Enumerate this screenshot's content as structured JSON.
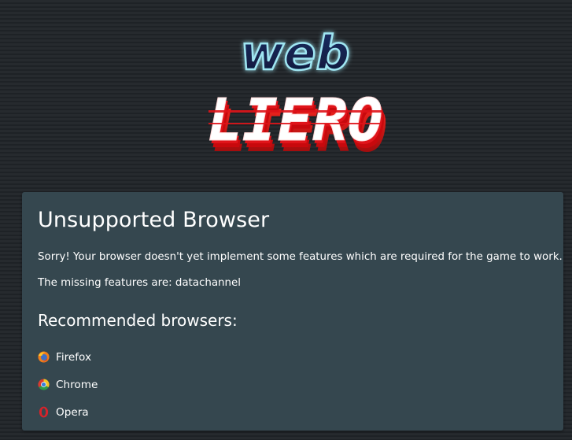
{
  "logo": {
    "top_text": "web",
    "bottom_text": "LIERO"
  },
  "panel": {
    "title": "Unsupported Browser",
    "message": "Sorry! Your browser doesn't yet implement some features which are required for the game to work.",
    "missing_label": "The missing features are: datachannel",
    "recommended_heading": "Recommended browsers:",
    "browsers": [
      {
        "label": "Firefox",
        "icon": "firefox-icon"
      },
      {
        "label": "Chrome",
        "icon": "chrome-icon"
      },
      {
        "label": "Opera",
        "icon": "opera-icon"
      }
    ]
  },
  "colors": {
    "background": "#23272b",
    "panel": "#35474f",
    "logo_red": "#e0141a",
    "logo_blue_outline": "#9fe6f2"
  }
}
